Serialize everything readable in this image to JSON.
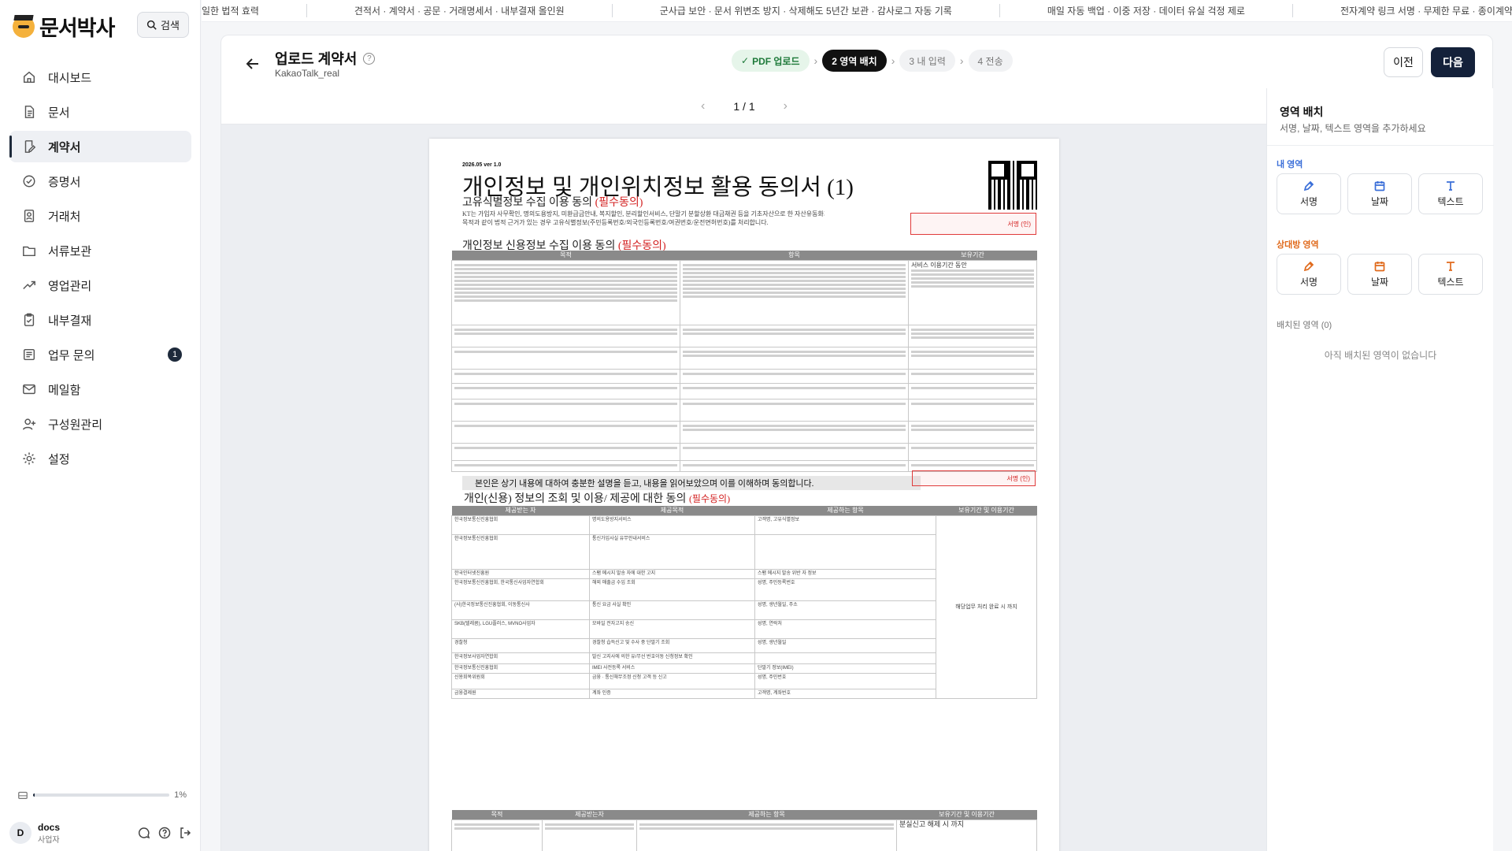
{
  "app": {
    "logo_text": "문서박사",
    "search_label": "검색"
  },
  "nav": [
    {
      "label": "대시보드",
      "icon": "home-icon"
    },
    {
      "label": "문서",
      "icon": "document-icon"
    },
    {
      "label": "계약서",
      "icon": "contract-edit-icon",
      "active": true
    },
    {
      "label": "증명서",
      "icon": "check-circle-icon"
    },
    {
      "label": "거래처",
      "icon": "contact-icon"
    },
    {
      "label": "서류보관",
      "icon": "folder-icon"
    },
    {
      "label": "영업관리",
      "icon": "trend-up-icon"
    },
    {
      "label": "내부결재",
      "icon": "clipboard-icon"
    },
    {
      "label": "업무 문의",
      "icon": "list-icon",
      "badge": "1"
    },
    {
      "label": "메일함",
      "icon": "mail-icon"
    },
    {
      "label": "구성원관리",
      "icon": "user-plus-icon"
    },
    {
      "label": "설정",
      "icon": "gear-icon"
    }
  ],
  "storage": {
    "percent_label": "1%",
    "used_fraction": 0.01
  },
  "user": {
    "avatar": "D",
    "name": "docs",
    "role": "사업자"
  },
  "ticker": [
    "일한 법적 효력",
    "견적서 · 계약서 · 공문 · 거래명세서 · 내부결재 올인원",
    "군사급 보안 · 문서 위변조 방지 · 삭제해도 5년간 보관 · 감사로그 자동 기록",
    "매일 자동 백업 · 이중 저장 · 데이터 유실 걱정 제로",
    "전자계약 링크 서명 · 무제한 무료 · 종이계약과 동일한 법적"
  ],
  "header": {
    "title": "업로드 계약서",
    "subtitle": "KakaoTalk_real",
    "help": "?",
    "steps": [
      {
        "label": "PDF 업로드",
        "state": "done"
      },
      {
        "label": "2 영역 배치",
        "state": "current"
      },
      {
        "label": "3 내 입력",
        "state": "todo"
      },
      {
        "label": "4 전송",
        "state": "todo"
      }
    ],
    "prev_label": "이전",
    "next_label": "다음"
  },
  "viewer": {
    "page_indicator": "1 / 1"
  },
  "document": {
    "version": "2026.05 ver 1.0",
    "title": "개인정보 및 개인위치정보 활용 동의서 (1)",
    "section1": "고유식별정보 수집 이용 동의",
    "section1_req": "(필수동의)",
    "section1_text": "KT는 가입자 사무확인, 명의도용방지, 미환급금안내, 복지할인, 분리할인서비스, 단말기 분할상환 대금채권 등을 기초자산으로 한 자산유동화거래",
    "section1_text2": "목적과 같이 법적 근거가 있는 경우 고유식별정보(주민등록번호/외국인등록번호/여권번호/운전면허번호)를 처리합니다.",
    "section2": "개인정보 신용정보 수집 이용 동의",
    "section2_req": "(필수동의)",
    "table1_headers": [
      "목적",
      "항목",
      "보유기간"
    ],
    "table1_retention": "서비스 이용기간 동안",
    "agree_text": "본인은 상기 내용에 대하여 충분한 설명을 듣고, 내용을 읽어보았으며 이를 이해하며 동의합니다.",
    "section3": "개인(신용) 정보의 조회 및 이용/ 제공에 대한 동의",
    "section3_req": "(필수동의)",
    "table2_headers": [
      "제공받는 자",
      "제공목적",
      "제공하는 항목",
      "보유기간 및 이용기간"
    ],
    "table2_rows": [
      [
        "한국정보통신진흥협회",
        "명의도용방지서비스",
        "고객명, 고유식별정보"
      ],
      [
        "한국정보통신진흥협회",
        "통신가입사실 유무안내서비스",
        ""
      ],
      [
        "한국인터넷진흥원",
        "스팸 메시지 발송 자에 대한 고지",
        "스팸 메시지 발송 위반 자 정보"
      ],
      [
        "한국정보통신진흥협회, 한국통신사업자연합회",
        "해외 매출금 수입 조회",
        "성명, 주민등록번호"
      ],
      [
        "(사)한국정보통신진흥협회, 이동통신사",
        "통신 요금 사실 확인",
        "성명, 생년월일, 주소"
      ],
      [
        "SKB(텔레콤), LGU플러스, MVNO사업자",
        "모바일 전자고지 송신",
        "성명, 연락처"
      ],
      [
        "경찰청",
        "경찰청 습득신고 및 수사 중 단말기 조회",
        "성명, 생년월일"
      ],
      [
        "한국정보사업자연합회",
        "발신 고지사에 의한 유/무선 번호이동 신청정보 확인",
        ""
      ],
      [
        "한국정보통신진흥협회",
        "IMEI 사전등록 서비스",
        "단말기 정보(IMEI)"
      ],
      [
        "신용회복위원회",
        "금융 · 통신채무조정 신청 고객 등 신고",
        "성명, 주민번호"
      ],
      [
        "금융결제원",
        "계좌 인증",
        "고객명, 계좌번호"
      ]
    ],
    "table2_retention": "해당업무 처리 완료 시 까지",
    "table3_headers": [
      "목적",
      "제공받는자",
      "제공하는 항목",
      "보유기간 및 이용기간"
    ],
    "table3_retention": "분실신고 해제 시 까지",
    "sig_label": "서명 (인)"
  },
  "panel": {
    "title": "영역 배치",
    "subtitle": "서명, 날짜, 텍스트 영역을 추가하세요",
    "mine_label": "내 영역",
    "other_label": "상대방 영역",
    "tools": [
      "서명",
      "날짜",
      "텍스트"
    ],
    "placed_label": "배치된 영역 (0)",
    "empty_text": "아직 배치된 영역이 없습니다"
  },
  "colors": {
    "primary": "#14213a",
    "mine": "#3a6ed8",
    "other": "#e06a1c",
    "signature_box": "#e03a3a",
    "step_done": "#1e7a3a"
  }
}
